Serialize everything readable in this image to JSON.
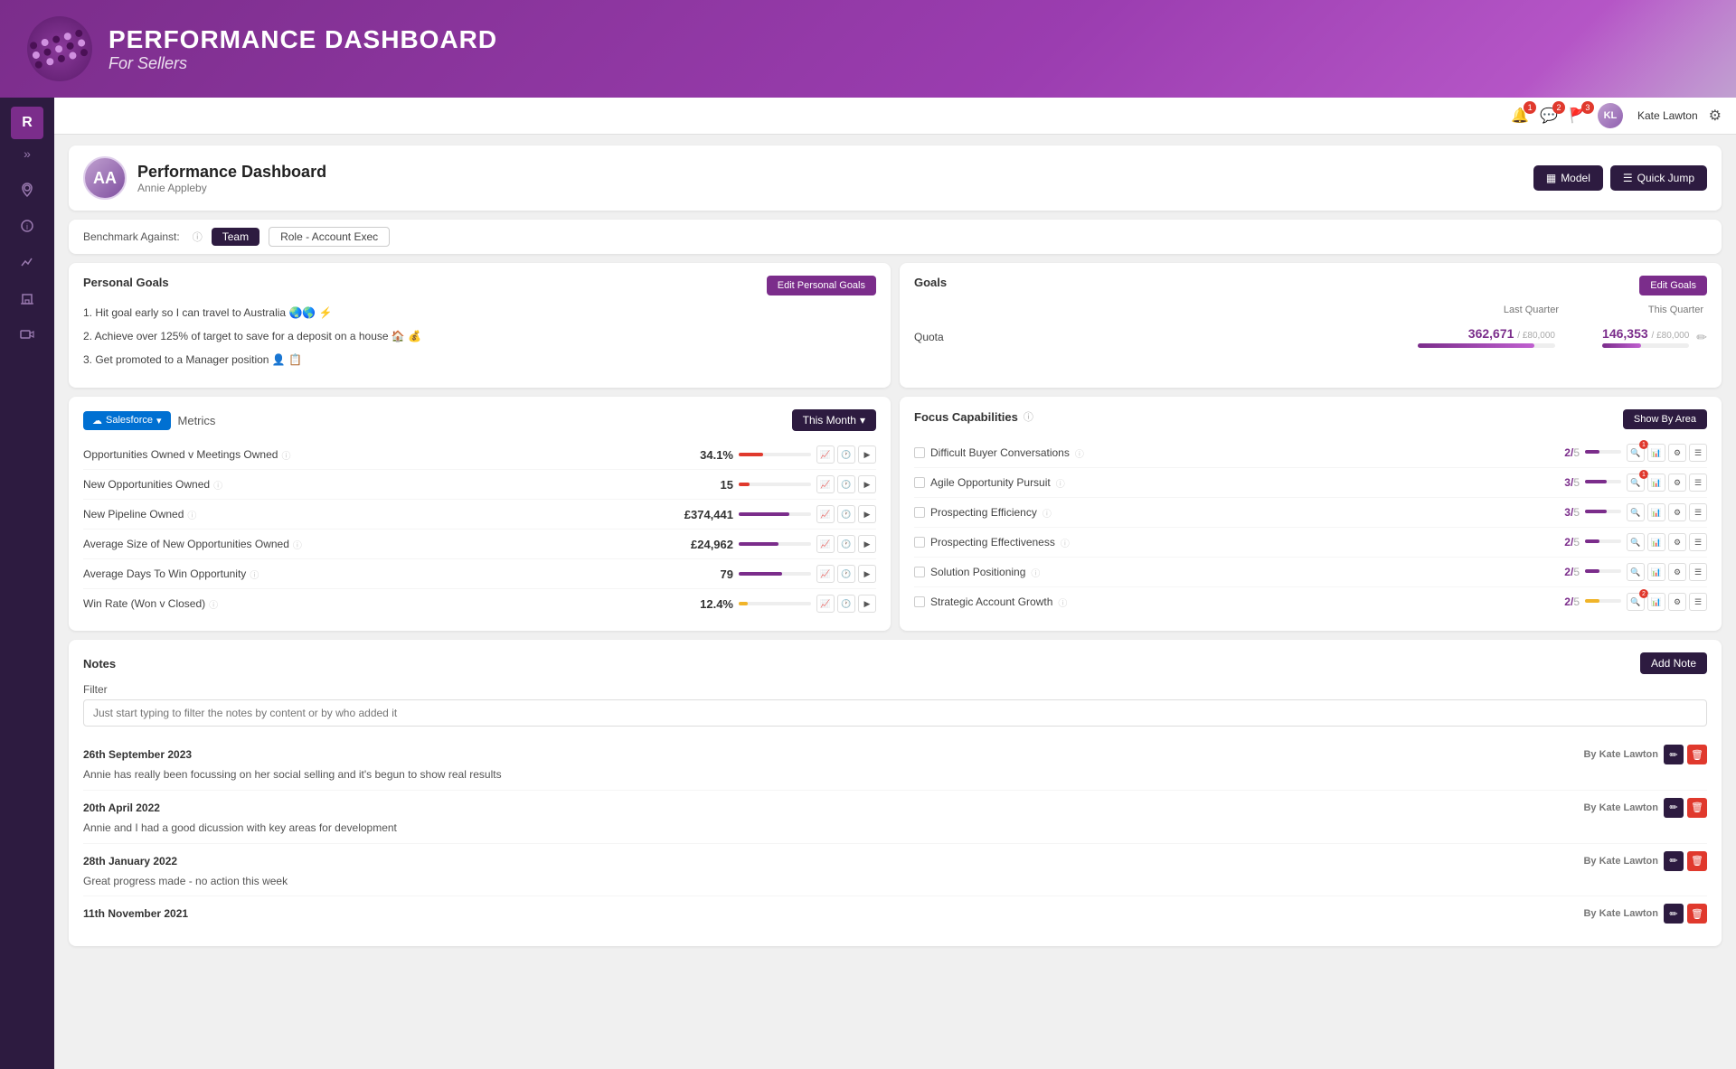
{
  "banner": {
    "title": "PERFORMANCE DASHBOARD",
    "subtitle": "For Sellers"
  },
  "topbar": {
    "user_name": "Kate Lawton",
    "notification_bell_count": "1",
    "chat_count": "2",
    "flag_count": "3"
  },
  "page_header": {
    "title": "Performance Dashboard",
    "subtitle": "Annie Appleby",
    "model_btn": "Model",
    "quickjump_btn": "Quick Jump"
  },
  "benchmark": {
    "label": "Benchmark Against:",
    "team_tag": "Team",
    "role_tag": "Role - Account Exec"
  },
  "personal_goals": {
    "title": "Personal Goals",
    "edit_btn": "Edit Personal Goals",
    "goals": [
      "1. Hit goal early so I can travel to Australia 🌏🌎 ⚡",
      "2. Achieve over 125% of target to save for a deposit on a house 🏠 💰",
      "3. Get promoted to a Manager position 👤 📋"
    ]
  },
  "goals": {
    "title": "Goals",
    "edit_btn": "Edit Goals",
    "last_quarter_label": "Last Quarter",
    "this_quarter_label": "This Quarter",
    "quota_label": "Quota",
    "last_quarter_value": "362,671",
    "last_quarter_sub": "/ £80,000",
    "this_quarter_value": "146,353",
    "this_quarter_sub": "/ £80,000",
    "last_quarter_pct": 85,
    "this_quarter_pct": 45
  },
  "metrics": {
    "salesforce_label": "Salesforce",
    "metrics_label": "Metrics",
    "month_btn": "This Month",
    "rows": [
      {
        "name": "Opportunities Owned v Meetings Owned",
        "value": "34.1%",
        "bar_pct": 34,
        "bar_color": "red"
      },
      {
        "name": "New Opportunities Owned",
        "value": "15",
        "bar_pct": 15,
        "bar_color": "red"
      },
      {
        "name": "New Pipeline Owned",
        "value": "£374,441",
        "bar_pct": 70,
        "bar_color": "purple"
      },
      {
        "name": "Average Size of New Opportunities Owned",
        "value": "£24,962",
        "bar_pct": 55,
        "bar_color": "purple"
      },
      {
        "name": "Average Days To Win Opportunity",
        "value": "79",
        "bar_pct": 60,
        "bar_color": "purple"
      },
      {
        "name": "Win Rate (Won v Closed)",
        "value": "12.4%",
        "bar_pct": 12,
        "bar_color": "yellow"
      }
    ]
  },
  "focus_capabilities": {
    "title": "Focus Capabilities",
    "show_by_area_btn": "Show By Area",
    "rows": [
      {
        "name": "Difficult Buyer Conversations",
        "score": "2",
        "max": "5",
        "bar_pct": 40,
        "bar_color": "#7b2d8b",
        "badge": 1
      },
      {
        "name": "Agile Opportunity Pursuit",
        "score": "3",
        "max": "5",
        "bar_pct": 60,
        "bar_color": "#7b2d8b",
        "badge": 1
      },
      {
        "name": "Prospecting Efficiency",
        "score": "3",
        "max": "5",
        "bar_pct": 60,
        "bar_color": "#7b2d8b",
        "badge": 0
      },
      {
        "name": "Prospecting Effectiveness",
        "score": "2",
        "max": "5",
        "bar_pct": 40,
        "bar_color": "#7b2d8b",
        "badge": 0
      },
      {
        "name": "Solution Positioning",
        "score": "2",
        "max": "5",
        "bar_pct": 40,
        "bar_color": "#7b2d8b",
        "badge": 0
      },
      {
        "name": "Strategic Account Growth",
        "score": "2",
        "max": "5",
        "bar_pct": 40,
        "bar_color": "#f0b429",
        "badge": 2
      }
    ]
  },
  "notes": {
    "title": "Notes",
    "add_btn": "Add Note",
    "filter_label": "Filter",
    "filter_placeholder": "Just start typing to filter the notes by content or by who added it",
    "items": [
      {
        "date": "26th September 2023",
        "by": "By Kate Lawton",
        "text": "Annie has really been focussing on her social selling and it's begun to show real results"
      },
      {
        "date": "20th April 2022",
        "by": "By Kate Lawton",
        "text": "Annie and I had a good dicussion with key areas for development"
      },
      {
        "date": "28th January 2022",
        "by": "By Kate Lawton",
        "text": "Great progress made - no action this week"
      },
      {
        "date": "11th November 2021",
        "by": "By Kate Lawton",
        "text": ""
      }
    ]
  }
}
